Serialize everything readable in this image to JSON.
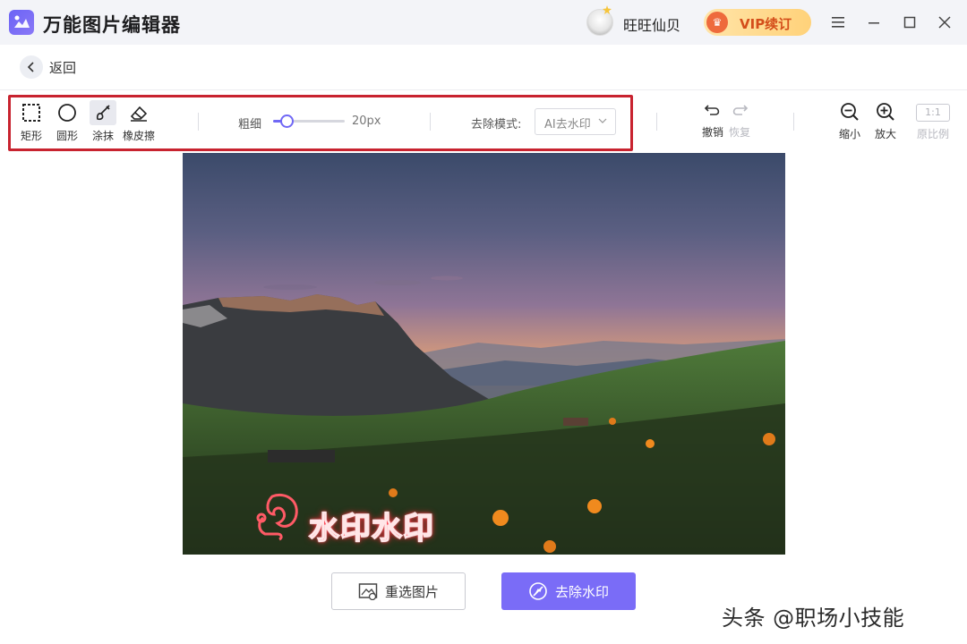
{
  "app": {
    "title": "万能图片编辑器"
  },
  "user": {
    "name": "旺旺仙贝"
  },
  "vip": {
    "label": "VIP续订"
  },
  "nav": {
    "back_label": "返回"
  },
  "tools": [
    {
      "label": "矩形",
      "icon": "rectangle-select-icon",
      "active": false
    },
    {
      "label": "圆形",
      "icon": "circle-select-icon",
      "active": false
    },
    {
      "label": "涂抹",
      "icon": "brush-icon",
      "active": true
    },
    {
      "label": "橡皮擦",
      "icon": "eraser-icon",
      "active": false
    }
  ],
  "brush": {
    "label": "粗细",
    "value": "20px",
    "level": 0.2
  },
  "removal": {
    "mode_label": "去除模式:",
    "mode_value": "AI去水印"
  },
  "history": {
    "undo_label": "撤销",
    "redo_label": "恢复"
  },
  "zoom": {
    "zoom_out_label": "缩小",
    "zoom_in_label": "放大",
    "ratio_box": "1:1",
    "original_label": "原比例"
  },
  "watermark": {
    "text": "水印水印"
  },
  "actions": {
    "reselect_label": "重选图片",
    "remove_label": "去除水印"
  },
  "credit": {
    "text": "头条 @职场小技能"
  },
  "colors": {
    "accent": "#7a6cf7",
    "highlight_border": "#c8232f",
    "vip_text": "#d44e1a",
    "watermark_red": "#ff4c5a"
  }
}
